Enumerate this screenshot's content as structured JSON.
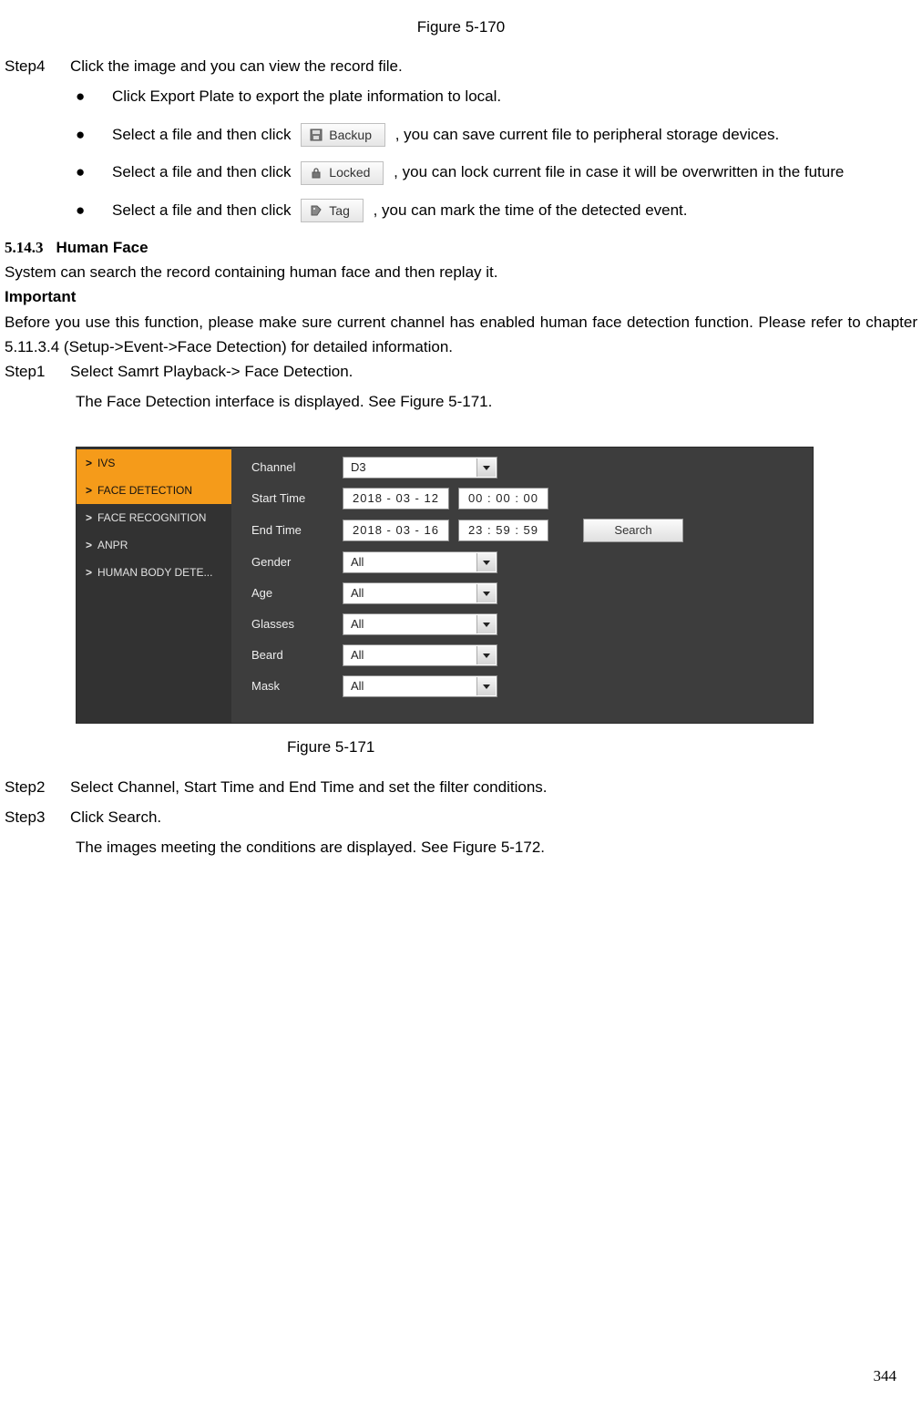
{
  "figure_top_caption": "Figure 5-170",
  "step4": {
    "label": "Step4",
    "text": "Click the image and you can view the record file."
  },
  "bullets": {
    "b1": "Click Export Plate to export the plate information to local.",
    "b2_pre": "Select a file and then click ",
    "b2_btn": "Backup",
    "b2_post": ", you can save current file to peripheral storage devices.",
    "b3_pre": "Select a file and then click ",
    "b3_btn": "Locked",
    "b3_post": ", you can lock current file in case it will be overwritten in the future",
    "b4_pre": "Select a file and then click ",
    "b4_btn": "Tag",
    "b4_post": ", you can mark the time of the detected event."
  },
  "section": {
    "num": "5.14.3",
    "title": "Human Face"
  },
  "p1": "System can search the record containing human face and then replay it.",
  "p_important": "Important",
  "p2": "Before you use this function, please make sure current channel has enabled human face detection function. Please refer to chapter 5.11.3.4 (Setup->Event->Face Detection) for detailed information.",
  "step1": {
    "label": "Step1",
    "text": "Select Samrt Playback-> Face Detection.",
    "text2": "The Face Detection interface is displayed. See Figure 5-171."
  },
  "ui": {
    "sidebar": {
      "items": [
        {
          "label": "IVS",
          "selected": true
        },
        {
          "label": "FACE DETECTION",
          "selected": true
        },
        {
          "label": "FACE RECOGNITION",
          "selected": false
        },
        {
          "label": "ANPR",
          "selected": false
        },
        {
          "label": "HUMAN BODY DETE...",
          "selected": false
        }
      ]
    },
    "form": {
      "channel_label": "Channel",
      "channel_value": "D3",
      "start_label": "Start Time",
      "start_date": "2018  -  03   -   12",
      "start_time": "00   :   00   :   00",
      "end_label": "End Time",
      "end_date": "2018  -  03   -   16",
      "end_time": "23   :   59   :   59",
      "search_btn": "Search",
      "gender_label": "Gender",
      "gender_value": "All",
      "age_label": "Age",
      "age_value": "All",
      "glasses_label": "Glasses",
      "glasses_value": "All",
      "beard_label": "Beard",
      "beard_value": "All",
      "mask_label": "Mask",
      "mask_value": "All"
    }
  },
  "figure_bottom_caption": "Figure 5-171",
  "step2": {
    "label": "Step2",
    "text": "Select Channel, Start Time and End Time and set the filter conditions."
  },
  "step3": {
    "label": "Step3",
    "text": "Click Search.",
    "text2": "The images meeting the conditions are displayed. See Figure 5-172."
  },
  "page_number": "344"
}
